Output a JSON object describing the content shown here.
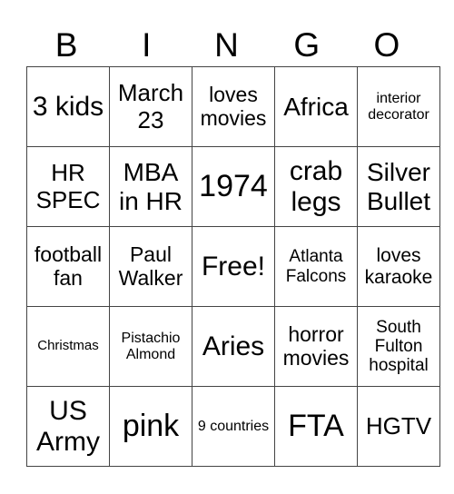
{
  "header": [
    "B",
    "I",
    "N",
    "G",
    "O"
  ],
  "rows": [
    [
      "3 kids",
      "March 23",
      "loves movies",
      "Africa",
      "interior decorator"
    ],
    [
      "HR SPEC",
      "MBA in HR",
      "1974",
      "crab legs",
      "Silver Bullet"
    ],
    [
      "football fan",
      "Paul Walker",
      "Free!",
      "Atlanta Falcons",
      "loves karaoke"
    ],
    [
      "Christmas",
      "Pistachio Almond",
      "Aries",
      "horror movies",
      "South Fulton hospital"
    ],
    [
      "US Army",
      "pink",
      "9 countries",
      "FTA",
      "HGTV"
    ]
  ]
}
